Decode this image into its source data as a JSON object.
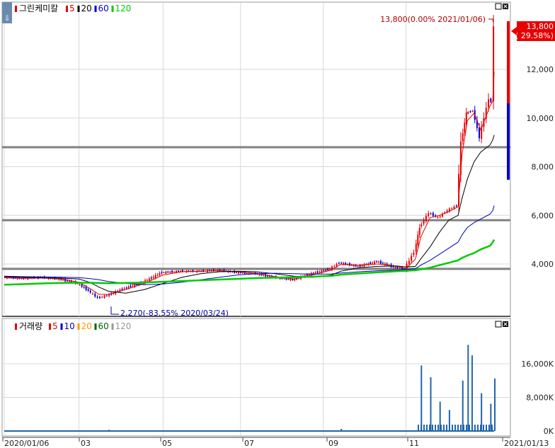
{
  "header": {
    "price_title": "그린케미칼",
    "price_legend": [
      {
        "label": "5",
        "color": "#e60000"
      },
      {
        "label": "20",
        "color": "#000000"
      },
      {
        "label": "60",
        "color": "#0000cc"
      },
      {
        "label": "120",
        "color": "#00cc00"
      }
    ],
    "volume_title": "거래량",
    "volume_legend": [
      {
        "label": "5",
        "color": "#e60000"
      },
      {
        "label": "10",
        "color": "#0000cc"
      },
      {
        "label": "20",
        "color": "#ff9900"
      },
      {
        "label": "60",
        "color": "#006600"
      },
      {
        "label": "120",
        "color": "#999999"
      }
    ]
  },
  "annotations": {
    "max_label": "13,800(0.00% 2021/01/06)",
    "min_label": "2,270(-83.55% 2020/03/24)",
    "current_price": "13,800",
    "current_change": "( 29.58%)"
  },
  "colors": {
    "up": "#e60000",
    "down": "#0000cc",
    "grid": "#d8d8d8",
    "hline": "#808080"
  },
  "chart_data": [
    {
      "type": "candlestick",
      "title": "그린케미칼",
      "ylim": [
        2000,
        14500
      ],
      "y_ticks": [
        {
          "value": 4000,
          "label": "4,000"
        },
        {
          "value": 6000,
          "label": "6,000"
        },
        {
          "value": 8000,
          "label": "8,000"
        },
        {
          "value": 10000,
          "label": "10,000"
        },
        {
          "value": 12000,
          "label": "12,000"
        }
      ],
      "x_ticks": [
        "2020/01/06",
        "03",
        "05",
        "07",
        "09",
        "11",
        "2021/01/13"
      ],
      "horizontal_lines": [
        8800,
        5800,
        3800
      ],
      "close_path": [
        [
          "2020/01/06",
          3450
        ],
        [
          "2020/01/20",
          3400
        ],
        [
          "2020/02/03",
          3450
        ],
        [
          "2020/02/17",
          3380
        ],
        [
          "2020/03/02",
          3200
        ],
        [
          "2020/03/10",
          2900
        ],
        [
          "2020/03/17",
          2600
        ],
        [
          "2020/03/24",
          2700
        ],
        [
          "2020/04/06",
          3000
        ],
        [
          "2020/04/20",
          3250
        ],
        [
          "2020/05/04",
          3650
        ],
        [
          "2020/05/18",
          3700
        ],
        [
          "2020/06/01",
          3700
        ],
        [
          "2020/06/15",
          3750
        ],
        [
          "2020/06/29",
          3650
        ],
        [
          "2020/07/13",
          3600
        ],
        [
          "2020/07/27",
          3450
        ],
        [
          "2020/08/10",
          3350
        ],
        [
          "2020/08/24",
          3600
        ],
        [
          "2020/09/07",
          3800
        ],
        [
          "2020/09/14",
          4050
        ],
        [
          "2020/09/28",
          3900
        ],
        [
          "2020/10/12",
          4100
        ],
        [
          "2020/10/26",
          3850
        ],
        [
          "2020/11/02",
          3800
        ],
        [
          "2020/11/09",
          4500
        ],
        [
          "2020/11/13",
          5500
        ],
        [
          "2020/11/20",
          6100
        ],
        [
          "2020/11/27",
          5900
        ],
        [
          "2020/12/04",
          6200
        ],
        [
          "2020/12/11",
          6400
        ],
        [
          "2020/12/14",
          9000
        ],
        [
          "2020/12/18",
          10200
        ],
        [
          "2020/12/23",
          10300
        ],
        [
          "2020/12/28",
          9200
        ],
        [
          "2021/01/04",
          10800
        ],
        [
          "2021/01/06",
          10650
        ],
        [
          "2021/01/07",
          13800
        ]
      ],
      "moving_averages": [
        {
          "name": "5",
          "values": [
            3450,
            3420,
            3420,
            3400,
            3250,
            3000,
            2750,
            2750,
            2950,
            3200,
            3550,
            3680,
            3700,
            3720,
            3680,
            3620,
            3480,
            3380,
            3550,
            3750,
            3980,
            3950,
            4000,
            3900,
            3820,
            4200,
            5100,
            5900,
            6000,
            6150,
            6350,
            8500,
            9900,
            10200,
            9500,
            10500,
            10700,
            11900
          ]
        },
        {
          "name": "20",
          "values": [
            3480,
            3450,
            3430,
            3420,
            3380,
            3250,
            3050,
            2880,
            2800,
            2950,
            3200,
            3450,
            3600,
            3680,
            3700,
            3680,
            3600,
            3500,
            3450,
            3550,
            3700,
            3850,
            3900,
            3920,
            3880,
            3900,
            4200,
            4700,
            5300,
            5800,
            6000,
            6700,
            7500,
            8200,
            8600,
            8900,
            9100,
            9300
          ]
        },
        {
          "name": "60",
          "values": [
            3500,
            3480,
            3470,
            3460,
            3440,
            3400,
            3350,
            3280,
            3200,
            3150,
            3180,
            3250,
            3350,
            3450,
            3550,
            3600,
            3620,
            3600,
            3580,
            3590,
            3630,
            3680,
            3720,
            3750,
            3780,
            3800,
            3950,
            4150,
            4400,
            4650,
            4900,
            5200,
            5500,
            5700,
            5850,
            6050,
            6200,
            6400
          ]
        },
        {
          "name": "120",
          "values": [
            3150,
            3170,
            3200,
            3220,
            3230,
            3230,
            3220,
            3210,
            3220,
            3240,
            3270,
            3300,
            3330,
            3360,
            3390,
            3420,
            3440,
            3460,
            3480,
            3510,
            3560,
            3610,
            3660,
            3700,
            3720,
            3740,
            3780,
            3850,
            3950,
            4050,
            4150,
            4250,
            4350,
            4450,
            4600,
            4750,
            4900,
            5000
          ]
        }
      ]
    },
    {
      "type": "bar",
      "title": "거래량",
      "ylim": [
        0,
        21000000
      ],
      "y_ticks": [
        {
          "value": 0,
          "label": "0K"
        },
        {
          "value": 8000000,
          "label": "8,000K"
        },
        {
          "value": 16000000,
          "label": "16,000K"
        }
      ],
      "spikes": [
        {
          "date": "2020/03/24",
          "value": 300000
        },
        {
          "date": "2020/09/14",
          "value": 500000
        },
        {
          "date": "2020/11/13",
          "value": 15600000
        },
        {
          "date": "2020/11/20",
          "value": 12800000
        },
        {
          "date": "2020/11/27",
          "value": 7000000
        },
        {
          "date": "2020/12/04",
          "value": 5000000
        },
        {
          "date": "2020/12/14",
          "value": 12000000
        },
        {
          "date": "2020/12/18",
          "value": 20500000
        },
        {
          "date": "2020/12/21",
          "value": 18000000
        },
        {
          "date": "2020/12/28",
          "value": 9000000
        },
        {
          "date": "2021/01/04",
          "value": 6500000
        },
        {
          "date": "2021/01/07",
          "value": 12500000
        }
      ]
    }
  ]
}
